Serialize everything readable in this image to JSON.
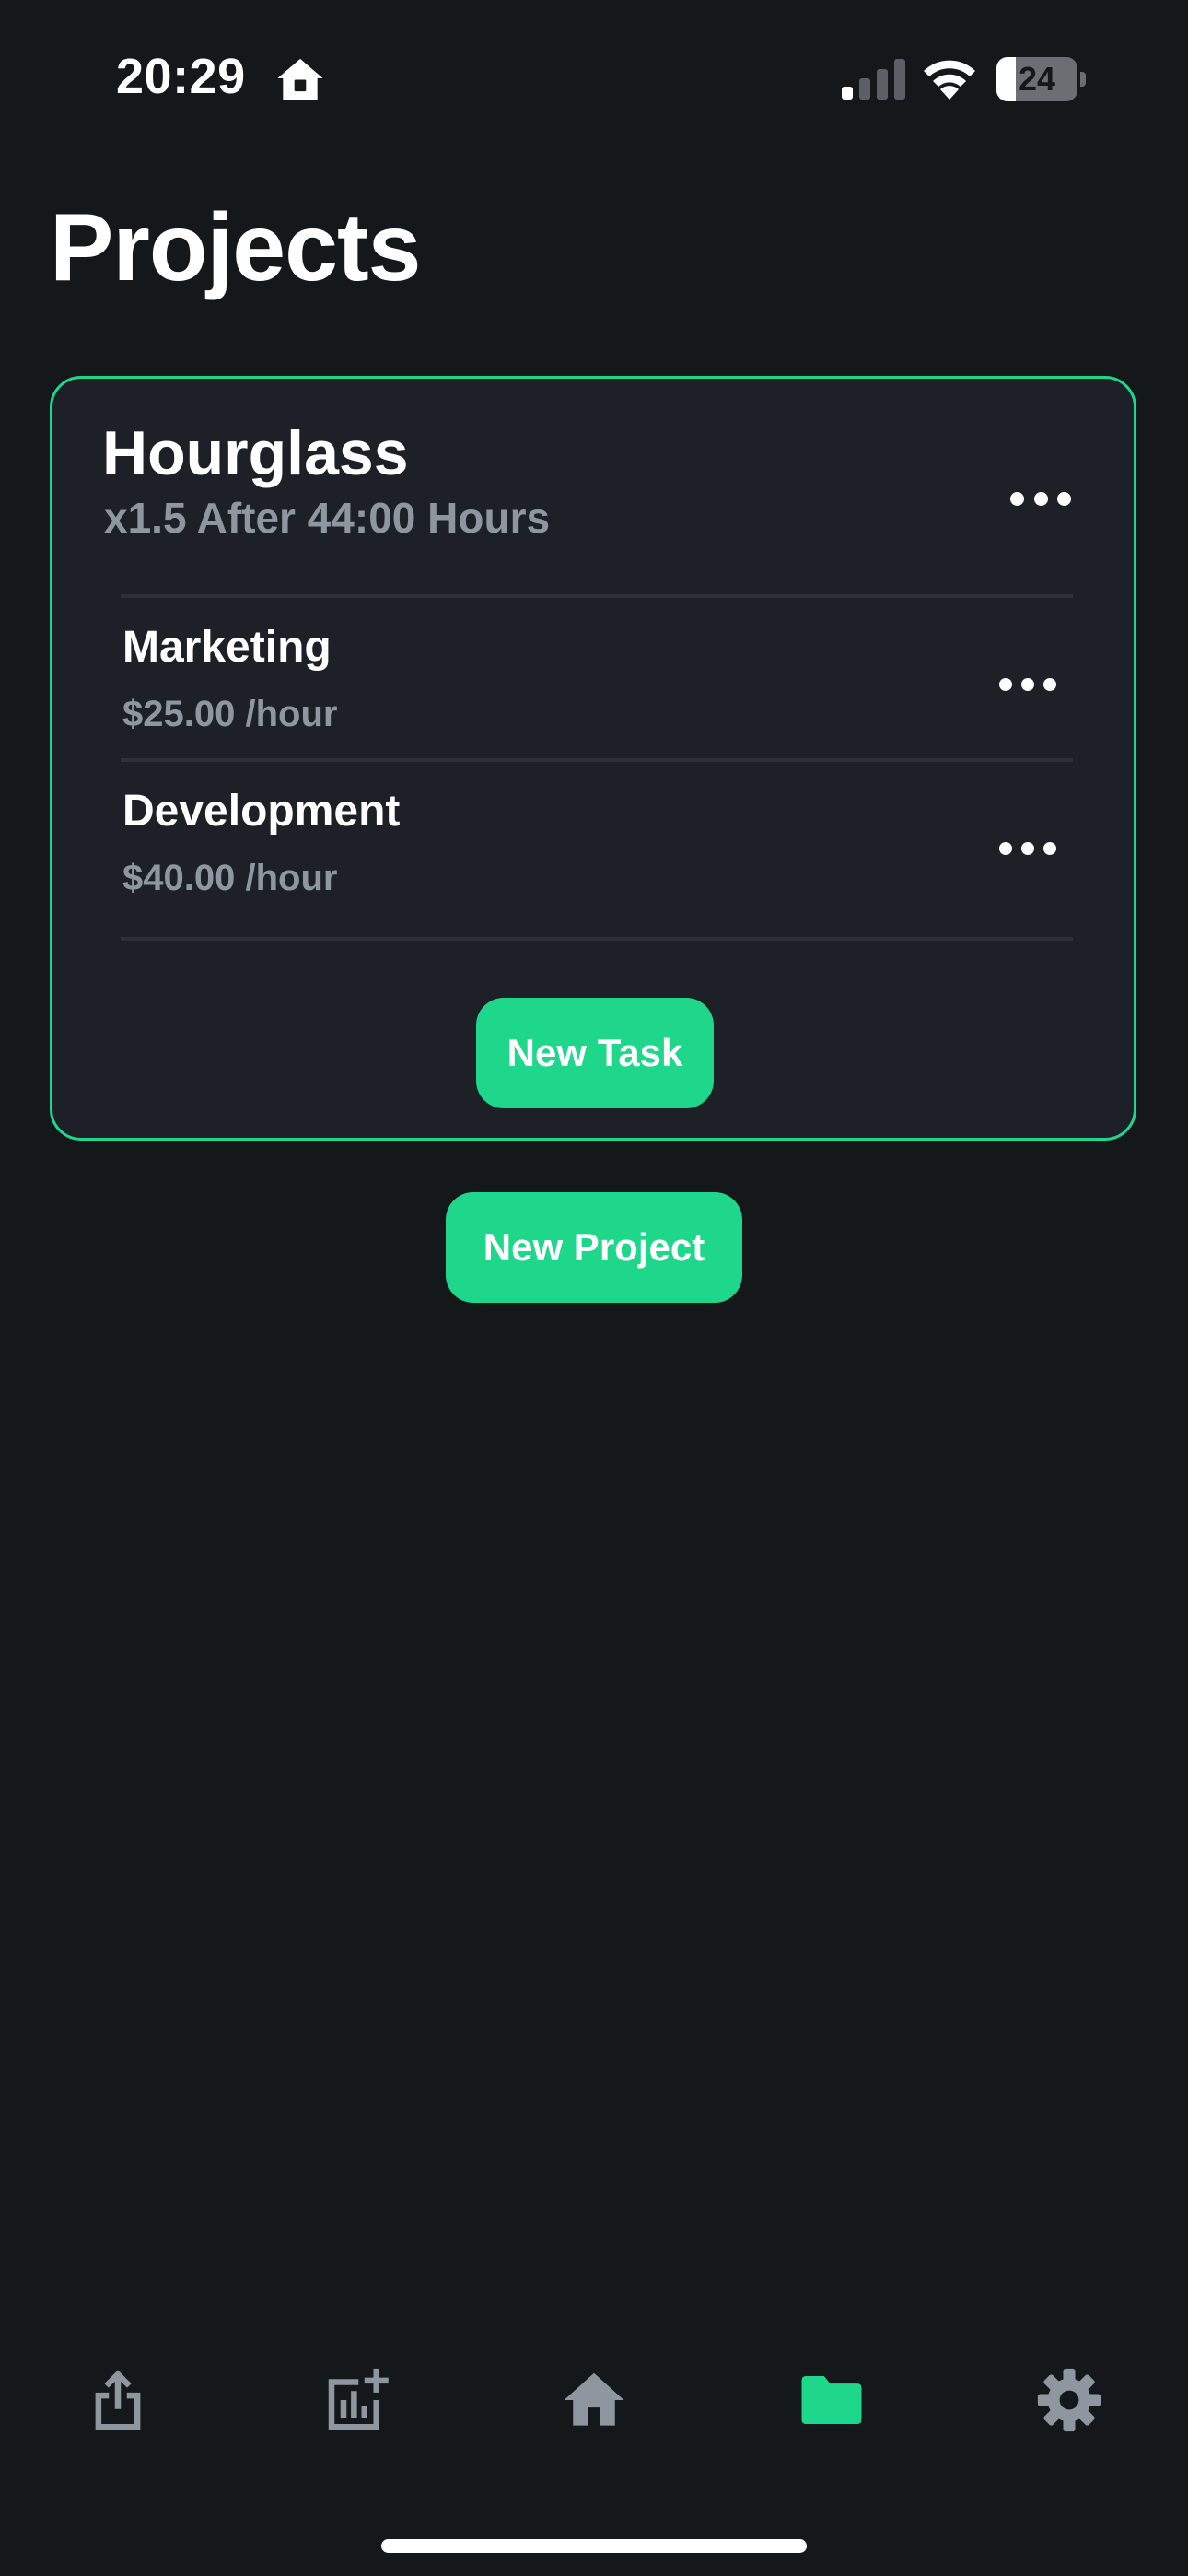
{
  "status_bar": {
    "time": "20:29",
    "battery_level": "24",
    "battery_fraction": 0.24,
    "icons": [
      "home-icon",
      "cellular-signal-icon",
      "wifi-icon",
      "battery-icon"
    ]
  },
  "page": {
    "title": "Projects"
  },
  "project": {
    "name": "Hourglass",
    "subtitle": "x1.5 After 44:00 Hours",
    "tasks": [
      {
        "name": "Marketing",
        "rate": "$25.00 /hour"
      },
      {
        "name": "Development",
        "rate": "$40.00 /hour"
      }
    ],
    "new_task_label": "New Task"
  },
  "actions": {
    "new_project_label": "New Project"
  },
  "tab_bar": {
    "items": [
      {
        "icon": "share-icon",
        "active": false
      },
      {
        "icon": "add-chart-icon",
        "active": false
      },
      {
        "icon": "home-icon",
        "active": false
      },
      {
        "icon": "folder-icon",
        "active": true
      },
      {
        "icon": "gear-icon",
        "active": false
      }
    ]
  },
  "colors": {
    "background": "#15181b",
    "card": "#1d2127",
    "accent": "#1fd78b",
    "muted_text": "#8e979f",
    "inactive_icon": "#8e979f"
  }
}
